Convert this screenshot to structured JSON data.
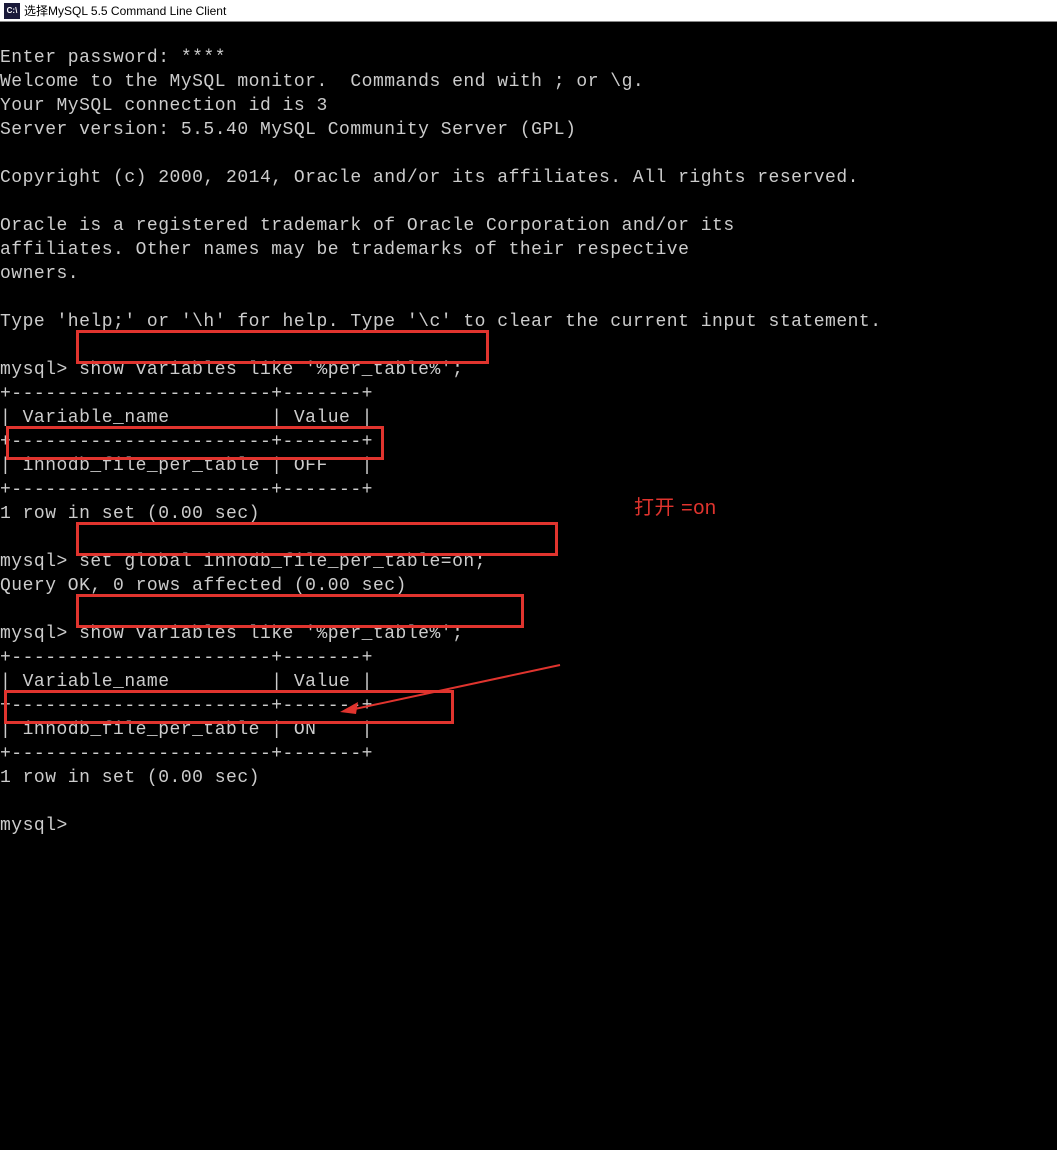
{
  "titlebar": {
    "icon_text": "C:\\",
    "title": "选择MySQL 5.5 Command Line Client"
  },
  "terminal": {
    "lines": {
      "l0": "Enter password: ****",
      "l1": "Welcome to the MySQL monitor.  Commands end with ; or \\g.",
      "l2": "Your MySQL connection id is 3",
      "l3": "Server version: 5.5.40 MySQL Community Server (GPL)",
      "l4": "",
      "l5": "Copyright (c) 2000, 2014, Oracle and/or its affiliates. All rights reserved.",
      "l6": "",
      "l7": "Oracle is a registered trademark of Oracle Corporation and/or its",
      "l8": "affiliates. Other names may be trademarks of their respective",
      "l9": "owners.",
      "l10": "",
      "l11": "Type 'help;' or '\\h' for help. Type '\\c' to clear the current input statement.",
      "l12": "",
      "l13": "mysql> show variables like '%per_table%';",
      "l14": "+-----------------------+-------+",
      "l15": "| Variable_name         | Value |",
      "l16": "+-----------------------+-------+",
      "l17": "| innodb_file_per_table | OFF   |",
      "l18": "+-----------------------+-------+",
      "l19": "1 row in set (0.00 sec)",
      "l20": "",
      "l21": "mysql> set global innodb_file_per_table=on;",
      "l22": "Query OK, 0 rows affected (0.00 sec)",
      "l23": "",
      "l24": "mysql> show variables like '%per_table%';",
      "l25": "+-----------------------+-------+",
      "l26": "| Variable_name         | Value |",
      "l27": "+-----------------------+-------+",
      "l28": "| innodb_file_per_table | ON    |",
      "l29": "+-----------------------+-------+",
      "l30": "1 row in set (0.00 sec)",
      "l31": "",
      "l32": "mysql>"
    }
  },
  "annotations": {
    "open_on": "打开 =on"
  }
}
